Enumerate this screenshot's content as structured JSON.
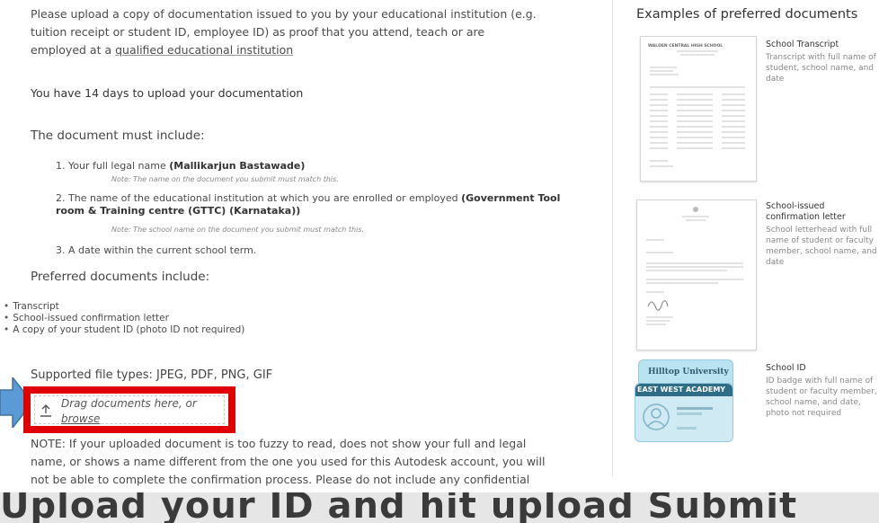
{
  "intro": {
    "text": "Please upload a copy of documentation issued to you by your educational institution (e.g. tuition receipt or student ID, employee ID) as proof that you attend, teach or are employed at a ",
    "link": "qualified educational institution"
  },
  "deadline": "You have 14 days to upload your documentation",
  "must_include": {
    "heading": "The document must include:",
    "items": [
      {
        "num": "1.",
        "text": "Your full legal name ",
        "bold": "(Mallikarjun Bastawade)",
        "note": "Note: The name on the document you submit must match this."
      },
      {
        "num": "2.",
        "text": "The name of the educational institution at which you are enrolled or employed ",
        "bold": "(Government Tool room & Training centre (GTTC) (Karnataka))",
        "note": "Note: The school name on the document you submit must match this."
      },
      {
        "num": "3.",
        "text": "A date within the current school term.",
        "bold": "",
        "note": ""
      }
    ]
  },
  "preferred": {
    "heading": "Preferred documents include:",
    "items": [
      "Transcript",
      "School-issued confirmation letter",
      "A copy of your student ID (photo ID not required)"
    ]
  },
  "supported": "Supported file types: JPEG, PDF, PNG, GIF",
  "dropzone": {
    "icon": "upload-icon",
    "text1": "Drag documents here, or",
    "link": "browse"
  },
  "note": "NOTE: If your uploaded document is too fuzzy to read, does not show your full and legal name, or shows a name different from the one you used for this Autodesk account, you will not be able to complete the confirmation process. Please do not include any confidential information in the document you upload, such as social",
  "banner": "Upload your ID and hit upload Submit",
  "sidebar": {
    "title": "Examples of preferred documents",
    "examples": [
      {
        "title": "School Transcript",
        "desc": "Transcript with full name of student, school name, and date",
        "thumb_heading": "WALDEN CENTRAL HIGH SCHOOL"
      },
      {
        "title": "School-issued confirmation letter",
        "desc": "School letterhead with full name of student or faculty member, school name, and date"
      },
      {
        "title": "School ID",
        "desc": "ID badge with full name of student or faculty member, school name, and date, photo not required",
        "badge1": "Hilltop University",
        "badge2": "EAST WEST ACADEMY"
      }
    ]
  },
  "colors": {
    "highlight_border": "#e00000",
    "arrow": "#5b9bd5"
  }
}
